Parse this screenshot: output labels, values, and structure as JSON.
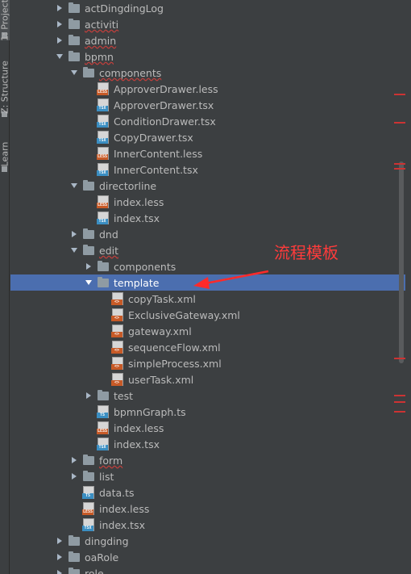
{
  "side_tabs": [
    {
      "label": "1: Project",
      "active": true
    },
    {
      "label": "Z: Structure",
      "active": false
    },
    {
      "label": "Learn",
      "active": false
    }
  ],
  "tree": [
    {
      "label": "actDingdingLog",
      "type": "folder",
      "depth": 3,
      "expanded": false,
      "error": false
    },
    {
      "label": "activiti",
      "type": "folder",
      "depth": 3,
      "expanded": false,
      "error": true
    },
    {
      "label": "admin",
      "type": "folder",
      "depth": 3,
      "expanded": false,
      "error": true
    },
    {
      "label": "bpmn",
      "type": "folder",
      "depth": 3,
      "expanded": true,
      "error": true
    },
    {
      "label": "components",
      "type": "folder",
      "depth": 4,
      "expanded": true,
      "error": true
    },
    {
      "label": "ApproverDrawer.less",
      "type": "less",
      "depth": 5,
      "error": false
    },
    {
      "label": "ApproverDrawer.tsx",
      "type": "tsx",
      "depth": 5,
      "error": false
    },
    {
      "label": "ConditionDrawer.tsx",
      "type": "tsx",
      "depth": 5,
      "error": false
    },
    {
      "label": "CopyDrawer.tsx",
      "type": "tsx",
      "depth": 5,
      "error": false
    },
    {
      "label": "InnerContent.less",
      "type": "less",
      "depth": 5,
      "error": false
    },
    {
      "label": "InnerContent.tsx",
      "type": "tsx",
      "depth": 5,
      "error": false
    },
    {
      "label": "directorline",
      "type": "folder",
      "depth": 4,
      "expanded": true,
      "error": false
    },
    {
      "label": "index.less",
      "type": "less",
      "depth": 5,
      "error": false
    },
    {
      "label": "index.tsx",
      "type": "tsx",
      "depth": 5,
      "error": false
    },
    {
      "label": "dnd",
      "type": "folder",
      "depth": 4,
      "expanded": false,
      "error": false
    },
    {
      "label": "edit",
      "type": "folder",
      "depth": 4,
      "expanded": true,
      "error": true
    },
    {
      "label": "components",
      "type": "folder",
      "depth": 5,
      "expanded": false,
      "error": false
    },
    {
      "label": "template",
      "type": "folder",
      "depth": 5,
      "expanded": true,
      "error": false,
      "selected": true
    },
    {
      "label": "copyTask.xml",
      "type": "xml",
      "depth": 6,
      "error": false
    },
    {
      "label": "ExclusiveGateway.xml",
      "type": "xml",
      "depth": 6,
      "error": false
    },
    {
      "label": "gateway.xml",
      "type": "xml",
      "depth": 6,
      "error": false
    },
    {
      "label": "sequenceFlow.xml",
      "type": "xml",
      "depth": 6,
      "error": false
    },
    {
      "label": "simpleProcess.xml",
      "type": "xml",
      "depth": 6,
      "error": false
    },
    {
      "label": "userTask.xml",
      "type": "xml",
      "depth": 6,
      "error": false
    },
    {
      "label": "test",
      "type": "folder",
      "depth": 5,
      "expanded": false,
      "error": false
    },
    {
      "label": "bpmnGraph.ts",
      "type": "ts",
      "depth": 5,
      "error": false
    },
    {
      "label": "index.less",
      "type": "less",
      "depth": 5,
      "error": false
    },
    {
      "label": "index.tsx",
      "type": "tsx",
      "depth": 5,
      "error": false
    },
    {
      "label": "form",
      "type": "folder",
      "depth": 4,
      "expanded": false,
      "error": true
    },
    {
      "label": "list",
      "type": "folder",
      "depth": 4,
      "expanded": false,
      "error": false
    },
    {
      "label": "data.ts",
      "type": "ts",
      "depth": 4,
      "error": false
    },
    {
      "label": "index.less",
      "type": "less",
      "depth": 4,
      "error": false
    },
    {
      "label": "index.tsx",
      "type": "tsx",
      "depth": 4,
      "error": false
    },
    {
      "label": "dingding",
      "type": "folder",
      "depth": 3,
      "expanded": false,
      "error": false
    },
    {
      "label": "oaRole",
      "type": "folder",
      "depth": 3,
      "expanded": false,
      "error": false
    },
    {
      "label": "role",
      "type": "folder",
      "depth": 3,
      "expanded": false,
      "error": false
    }
  ],
  "file_badges": {
    "less": "LESS",
    "tsx": "TSX",
    "ts": "TS",
    "xml": "<>"
  },
  "badge_colors": {
    "less": "#c75a27",
    "tsx": "#3a8ec2",
    "ts": "#3a8ec2",
    "xml": "#c75a27"
  },
  "annotation": {
    "text": "流程模板",
    "color": "#ff3b3b"
  },
  "colors": {
    "background": "#3c3f41",
    "selection": "#4b6eaf",
    "text": "#bbbbbb",
    "error_marker": "#cc3333"
  }
}
